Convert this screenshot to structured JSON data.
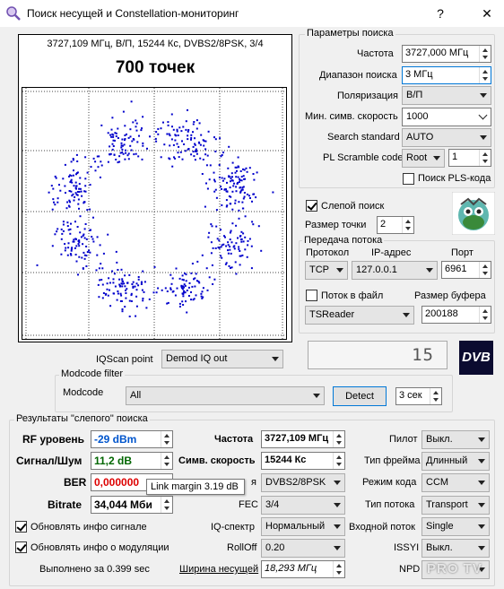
{
  "window": {
    "title": "Поиск несущей и Constellation-мониторинг",
    "help": "?",
    "close": "✕"
  },
  "constellation": {
    "info_line": "3727,109 МГц, В/П, 15244 Кс, DVBS2/8PSK, 3/4",
    "points_title": "700 точек",
    "dot_color": "#0000cc"
  },
  "search_params": {
    "group_title": "Параметры поиска",
    "frequency_label": "Частота",
    "frequency_value": "3727,000 МГц",
    "range_label": "Диапазон поиска",
    "range_value": "3 МГц",
    "polarization_label": "Поляризация",
    "polarization_value": "В/П",
    "min_sr_label": "Мин. симв. скорость",
    "min_sr_value": "1000",
    "standard_label": "Search standard",
    "standard_value": "AUTO",
    "pls_label": "PL Scramble code",
    "pls_mode": "Root",
    "pls_value": "1",
    "pls_search_label": "Поиск PLS-кода"
  },
  "blind": {
    "blind_search_label": "Слепой поиск",
    "point_size_label": "Размер точки",
    "point_size_value": "2"
  },
  "stream": {
    "group_title": "Передача потока",
    "protocol_label": "Протокол",
    "ip_label": "IP-адрес",
    "port_label": "Порт",
    "protocol_value": "TCP",
    "ip_value": "127.0.0.1",
    "port_value": "6961",
    "to_file_label": "Поток в файл",
    "buffer_label": "Размер буфера",
    "app_value": "TSReader",
    "buffer_value": "200188"
  },
  "iq": {
    "label": "IQScan point",
    "value": "Demod IQ out",
    "lcd_value": "15",
    "dvb_logo": "DVB"
  },
  "modcode": {
    "group_title": "Modcode filter",
    "label": "Modcode",
    "value": "All",
    "detect_label": "Detect",
    "time_value": "3 сек"
  },
  "results": {
    "group_title": "Результаты \"слепого\" поиска",
    "rf_label": "RF уровень",
    "rf_value": "-29 dBm",
    "snr_label": "Сигнал/Шум",
    "snr_value": "11,2 dB",
    "ber_label": "BER",
    "ber_value": "0,000000",
    "bitrate_label": "Bitrate",
    "bitrate_value": "34,044 Мби",
    "tooltip": "Link margin 3.19 dB",
    "freq_label": "Частота",
    "freq_value": "3727,109 МГц",
    "sr_label": "Симв. скорость",
    "sr_value": "15244 Кс",
    "mod_label": "я",
    "mod_value": "DVBS2/8PSK",
    "fec_label": "FEC",
    "fec_value": "3/4",
    "iq_label": "IQ-спектр",
    "iq_value": "Нормальный",
    "rolloff_label": "RollOff",
    "rolloff_value": "0.20",
    "bw_label": "Ширина несущей",
    "bw_value": "18,293 МГц",
    "pilot_label": "Пилот",
    "pilot_value": "Выкл.",
    "frame_label": "Тип фрейма",
    "frame_value": "Длинный",
    "code_label": "Режим кода",
    "code_value": "CCM",
    "stream_type_label": "Тип потока",
    "stream_type_value": "Transport",
    "input_label": "Входной поток",
    "input_value": "Single",
    "issyi_label": "ISSYI",
    "issyi_value": "Выкл.",
    "npd_label": "NPD",
    "update_signal_label": "Обновлять инфо сигнале",
    "update_mod_label": "Обновлять инфо о модуляции",
    "done_label": "Выполнено за 0.399 sec",
    "watermark": "PRO TV"
  }
}
